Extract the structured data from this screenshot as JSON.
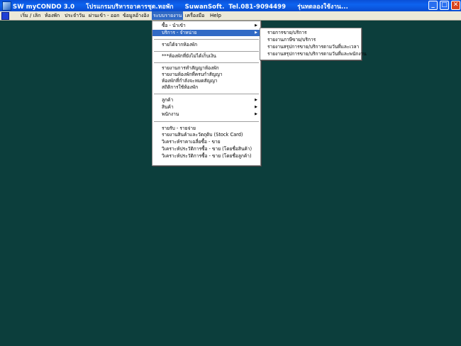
{
  "titlebar": {
    "app_name": "SW myCONDO 3.0",
    "subtitle": "โปรแกรมบริหารอาคารชุด.หอพัก",
    "company": "SuwanSoft.",
    "phone": "Tel.081-9094499",
    "edition": "รุ่นทดลองใช้งาน..."
  },
  "window_buttons": {
    "minimize": "_",
    "maximize": "□",
    "close": "✕"
  },
  "menubar": {
    "items": [
      "เริ่ม / เลิก",
      "ห้องพัก",
      "ประจำวัน",
      "ผ่านเข้า - ออก",
      "ข้อมูลอ้างอิง",
      "ระบบรายงาน",
      "เครื่องมือ",
      "Help"
    ],
    "active_index": 5
  },
  "report_menu": {
    "items": [
      {
        "label": "ซื้อ - นำเข้า",
        "submenu": true
      },
      {
        "label": "บริการ - จำหน่าย",
        "submenu": true,
        "active": true
      },
      {
        "label": "รายได้จากห้องพัก",
        "submenu": false
      },
      {
        "label": "***ห้องพักที่ยังไม่ได้เก็บเงิน",
        "submenu": false
      },
      {
        "label": "รายงานการทำสัญญาห้องพัก",
        "submenu": false
      },
      {
        "label": "รายงานห้องพักที่ครบกำสัญญา",
        "submenu": false
      },
      {
        "label": "ห้องพักที่กำลังจะหมดสัญญา",
        "submenu": false
      },
      {
        "label": "สถิติการใช้ห้องพัก",
        "submenu": false
      },
      {
        "label": "ลูกค้า",
        "submenu": true
      },
      {
        "label": "สินค้า",
        "submenu": true
      },
      {
        "label": "พนักงาน",
        "submenu": true
      },
      {
        "label": "รายรับ - รายจ่าย",
        "submenu": false
      },
      {
        "label": "รายงานสินค้าและวัตถุดิบ (Stock Card)",
        "submenu": false
      },
      {
        "label": "วิเคราะห์ราคาเฉลี่ยซื้อ - ขาย",
        "submenu": false
      },
      {
        "label": "วิเคราะห์ประวัติการซื้อ - ขาย (โดยชื่อสินค้า)",
        "submenu": false
      },
      {
        "label": "วิเคราะห์ประวัติการซื้อ - ขาย (โดยชื่อลูกค้า)",
        "submenu": false
      }
    ]
  },
  "service_submenu": {
    "items": [
      "รายการขาย/บริการ",
      "รายงานภาษีขาย/บริการ",
      "รายงานสรุปการขาย/บริการตามวันที่และเวลา",
      "รายงานสรุปการขาย/บริการตามวันที่และพนักงาน"
    ]
  },
  "colors": {
    "desktop": "#0c3e3c",
    "highlight": "#316ac5",
    "titlebar": "#0a4fd6"
  }
}
